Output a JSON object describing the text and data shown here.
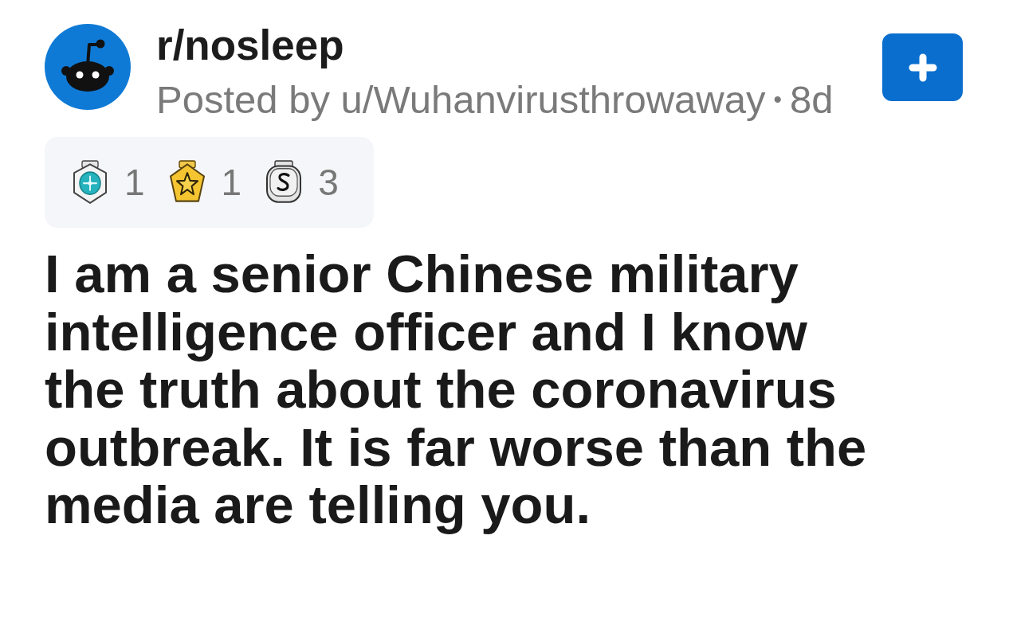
{
  "post": {
    "community": "r/nosleep",
    "byline": "Posted by u/Wuhanvirusthrowaway",
    "separator": "•",
    "age": "8d"
  },
  "awards": [
    {
      "kind": "gem",
      "count": "1"
    },
    {
      "kind": "star",
      "count": "1"
    },
    {
      "kind": "silver",
      "count": "3"
    }
  ],
  "title": "I am a senior Chinese military intelligence officer and I know the truth about the coronavirus outbreak. It is far worse than the media are telling you."
}
